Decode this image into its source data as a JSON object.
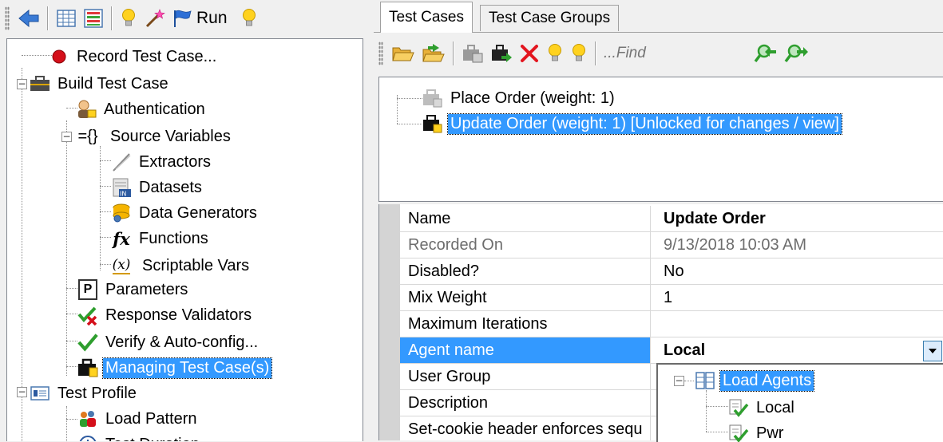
{
  "left_toolbar": {
    "run_label": "Run",
    "icons": [
      "back-arrow-icon",
      "grid-view-icon",
      "bar-chart-icon",
      "lightbulb-icon",
      "magic-wand-icon",
      "flag-icon",
      "lightbulb-icon"
    ]
  },
  "left_tree": {
    "items": [
      {
        "label": "Record Test Case...",
        "icon": "record-icon"
      },
      {
        "label": "Build Test Case",
        "icon": "briefcase-icon"
      },
      {
        "label": "Authentication",
        "icon": "user-key-icon"
      },
      {
        "label": "Source Variables",
        "icon": "braces-icon",
        "prefix": "={}"
      },
      {
        "label": "Extractors",
        "icon": "extractor-icon"
      },
      {
        "label": "Datasets",
        "icon": "dataset-icon",
        "badge": "IN"
      },
      {
        "label": "Data Generators",
        "icon": "data-generator-icon"
      },
      {
        "label": "Functions",
        "icon": "function-icon",
        "glyph": "fx"
      },
      {
        "label": "Scriptable Vars",
        "icon": "scriptable-var-icon",
        "glyph": "(x)"
      },
      {
        "label": "Parameters",
        "icon": "parameter-icon",
        "glyph": "P"
      },
      {
        "label": "Response Validators",
        "icon": "validator-icon"
      },
      {
        "label": "Verify & Auto-config...",
        "icon": "checkmark-icon"
      },
      {
        "label": "Managing Test Case(s)",
        "icon": "briefcase-icon",
        "selected": true
      },
      {
        "label": "Test Profile",
        "icon": "profile-icon"
      },
      {
        "label": "Load Pattern",
        "icon": "users-icon"
      },
      {
        "label": "Test Duration",
        "icon": "clock-icon"
      }
    ]
  },
  "tabs": [
    {
      "label": "Test Cases",
      "active": true
    },
    {
      "label": "Test Case Groups",
      "active": false
    }
  ],
  "right_toolbar": {
    "find_placeholder": "...Find",
    "icons": [
      "open-folder-icon",
      "import-folder-icon",
      "copy-case-icon",
      "export-case-icon",
      "delete-icon",
      "lightbulb-icon",
      "lightbulb-icon",
      "find-previous-icon",
      "find-next-icon"
    ]
  },
  "test_cases": [
    {
      "label": "Place Order (weight: 1)",
      "selected": false
    },
    {
      "label": "Update Order (weight: 1) [Unlocked for changes / view]",
      "selected": true
    }
  ],
  "properties": [
    {
      "key": "Name",
      "value": "Update Order",
      "value_bold": true
    },
    {
      "key": "Recorded On",
      "value": "9/13/2018 10:03 AM",
      "muted": true
    },
    {
      "key": "Disabled?",
      "value": "No"
    },
    {
      "key": "Mix Weight",
      "value": "1"
    },
    {
      "key": "Maximum Iterations",
      "value": ""
    },
    {
      "key": "Agent name",
      "value": "Local",
      "value_bold": true,
      "selected": true
    },
    {
      "key": "User Group",
      "value": ""
    },
    {
      "key": "Description",
      "value": ""
    },
    {
      "key": "Set-cookie header enforces sequ",
      "value": ""
    }
  ],
  "agent_popup": {
    "root": "Load Agents",
    "children": [
      "Local",
      "Pwr"
    ]
  },
  "colors": {
    "selection": "#3399ff",
    "window_bg": "#f0f0f0"
  }
}
